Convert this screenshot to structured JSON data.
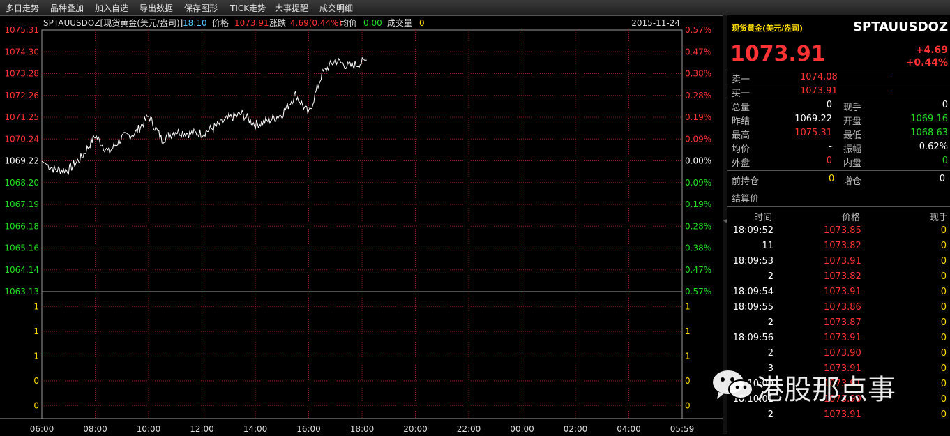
{
  "menu": [
    "多日走势",
    "品种叠加",
    "加入自选",
    "导出数据",
    "保存图形",
    "TICK走势",
    "大事提醒",
    "成交明细"
  ],
  "chart": {
    "header": {
      "symbol": "SPTAUUSDOZ[现货黄金(美元/盎司)]",
      "time": "18:10",
      "price_label": "价格",
      "price_value": "1073.91",
      "change_label": "涨跌",
      "change_value": "4.69(0.44%)",
      "avg_label": "均价",
      "avg_value": "0.00",
      "volume_label": "成交量",
      "volume_value": "0",
      "date": "2015-11-24"
    },
    "colors": {
      "up": "#ff3333",
      "down": "#22dd22",
      "flat": "#ffffff",
      "grid": "#8b1a1a",
      "line": "#ffffff",
      "volume_axis": "#ffdd00"
    },
    "price_axis_left": [
      "1075.31",
      "1074.30",
      "1073.28",
      "1072.26",
      "1071.25",
      "1070.24",
      "1069.22",
      "1068.20",
      "1067.19",
      "1066.18",
      "1065.16",
      "1064.14",
      "1063.13"
    ],
    "price_axis_right": [
      "0.57%",
      "0.47%",
      "0.38%",
      "0.28%",
      "0.19%",
      "0.09%",
      "0.00%",
      "0.09%",
      "0.19%",
      "0.28%",
      "0.38%",
      "0.47%",
      "0.57%"
    ],
    "volume_axis": [
      "1",
      "1",
      "1",
      "0",
      "0"
    ],
    "time_axis": [
      "06:00",
      "08:00",
      "10:00",
      "12:00",
      "14:00",
      "16:00",
      "18:00",
      "20:00",
      "22:00",
      "00:00",
      "02:00",
      "04:00",
      "05:59"
    ]
  },
  "chart_data": {
    "type": "line",
    "title": "SPTAUUSDOZ[现货黄金(美元/盎司)]",
    "xlabel": "",
    "ylabel": "",
    "ylim": [
      1063.13,
      1075.31
    ],
    "x": [
      "06:00",
      "06:30",
      "07:00",
      "07:30",
      "08:00",
      "08:30",
      "09:00",
      "09:30",
      "10:00",
      "10:30",
      "11:00",
      "11:30",
      "12:00",
      "12:30",
      "13:00",
      "13:30",
      "14:00",
      "14:30",
      "15:00",
      "15:30",
      "16:00",
      "16:30",
      "17:00",
      "17:30",
      "18:00",
      "18:10"
    ],
    "series": [
      {
        "values": [
          1069.2,
          1068.8,
          1068.8,
          1069.4,
          1070.4,
          1069.6,
          1070.3,
          1070.5,
          1071.3,
          1070.2,
          1070.6,
          1070.5,
          1070.5,
          1070.8,
          1071.2,
          1071.4,
          1070.9,
          1071.1,
          1071.4,
          1072.3,
          1071.4,
          1073.3,
          1073.9,
          1073.6,
          1073.8,
          1073.91
        ]
      }
    ],
    "volume": [
      1,
      1,
      1,
      0,
      0
    ],
    "reference_price": 1069.22
  },
  "panel": {
    "name": "现货黄金(美元/盎司)",
    "code": "SPTAUUSDOZ",
    "price": "1073.91",
    "change": "+4.69",
    "change_pct": "+0.44%",
    "ask_label": "卖一",
    "ask_price": "1074.08",
    "ask_vol": "-",
    "bid_label": "买一",
    "bid_price": "1073.91",
    "bid_vol": "-",
    "stats": [
      {
        "l1": "总量",
        "v1": "0",
        "l2": "现手",
        "v2": "0"
      },
      {
        "l1": "昨结",
        "v1": "1069.22",
        "l2": "开盘",
        "v2": "1069.16"
      },
      {
        "l1": "最高",
        "v1": "1075.31",
        "l2": "最低",
        "v2": "1068.63"
      },
      {
        "l1": "均价",
        "v1": "-",
        "l2": "振幅",
        "v2": "0.62%"
      },
      {
        "l1": "外盘",
        "v1": "0",
        "l2": "内盘",
        "v2": "0"
      }
    ],
    "prev_pos_label": "前持仓",
    "prev_pos_value": "0",
    "add_pos_label": "增仓",
    "add_pos_value": "0",
    "settle_label": "结算价",
    "ticks_header": {
      "time": "时间",
      "price": "价格",
      "hand": "现手"
    },
    "ticks": [
      {
        "time": "18:09:52",
        "price": "1073.85",
        "hand": "0"
      },
      {
        "time": "11",
        "price": "1073.82",
        "hand": "0"
      },
      {
        "time": "18:09:53",
        "price": "1073.91",
        "hand": "0"
      },
      {
        "time": "2",
        "price": "1073.82",
        "hand": "0"
      },
      {
        "time": "18:09:54",
        "price": "1073.91",
        "hand": "0"
      },
      {
        "time": "18:09:55",
        "price": "1073.86",
        "hand": "0"
      },
      {
        "time": "2",
        "price": "1073.87",
        "hand": "0"
      },
      {
        "time": "18:09:56",
        "price": "1073.91",
        "hand": "0"
      },
      {
        "time": "2",
        "price": "1073.90",
        "hand": "0"
      },
      {
        "time": "3",
        "price": "1073.91",
        "hand": "0"
      },
      {
        "time": "18:10:00",
        "price": "1073.91",
        "hand": "0"
      },
      {
        "time": "18:10:01",
        "price": "1073.90",
        "hand": "0"
      },
      {
        "time": "2",
        "price": "1073.91",
        "hand": "0"
      }
    ]
  },
  "watermark": {
    "icon": "wechat-icon",
    "text": "港股那点事"
  }
}
